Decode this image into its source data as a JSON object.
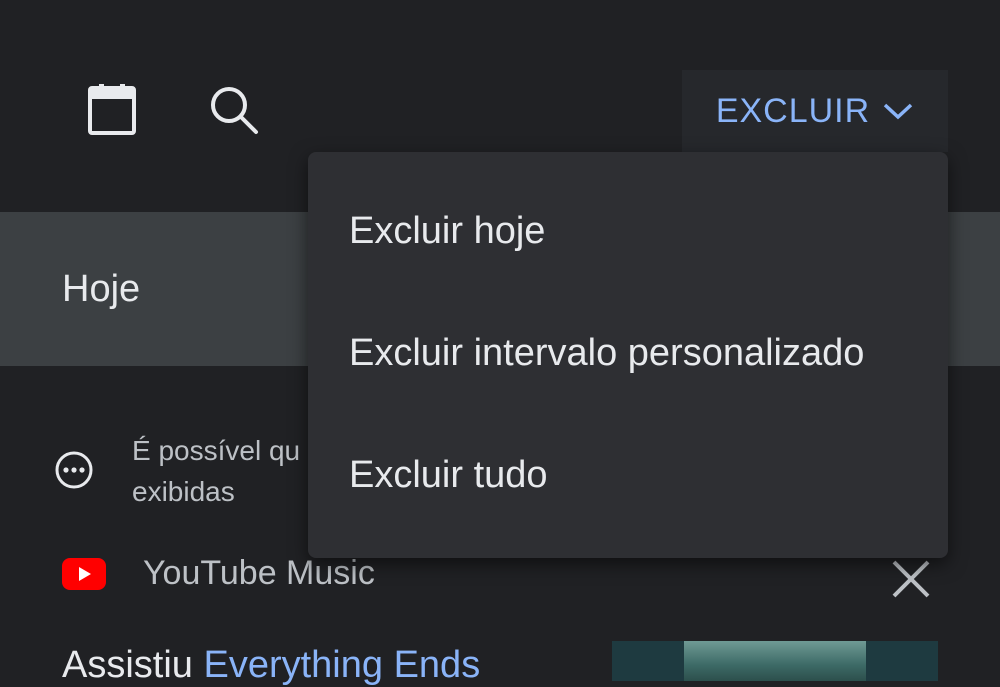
{
  "header": {
    "calendar_icon": "calendar-icon",
    "search_icon": "search-icon",
    "delete_button_label": "EXCLUIR",
    "delete_button_icon": "chevron-down-icon",
    "accent_color": "#8ab4f8"
  },
  "section": {
    "title": "Hoje"
  },
  "notice": {
    "icon": "more-horizontal-circle-icon",
    "text": "É possível qu",
    "text_line2": "exibidas"
  },
  "entry": {
    "app_name": "YouTube Music",
    "app_icon": "youtube-logo",
    "close_icon": "close-icon",
    "watched_prefix": "Assistiu ",
    "watched_title": "Everything Ends"
  },
  "menu": {
    "items": [
      {
        "label": "Excluir hoje"
      },
      {
        "label": "Excluir intervalo personalizado"
      },
      {
        "label": "Excluir tudo"
      }
    ]
  }
}
